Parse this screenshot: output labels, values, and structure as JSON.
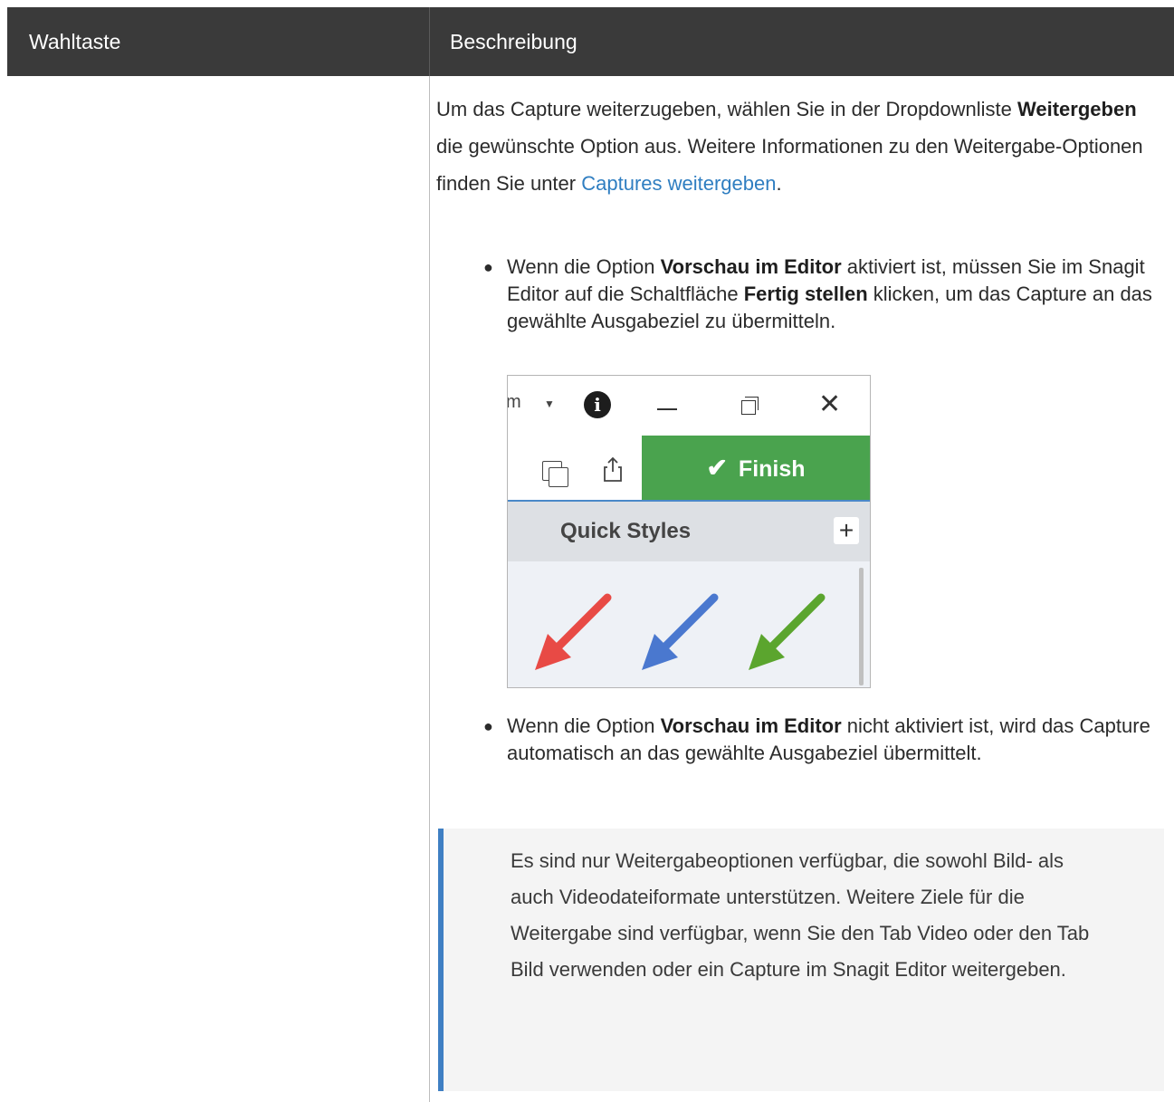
{
  "table": {
    "headers": [
      "Wahltaste",
      "Beschreibung"
    ]
  },
  "intro": {
    "t1": "Um das Capture weiterzugeben, wählen Sie in der Dropdownliste ",
    "b1": "Weitergeben",
    "t2": " die gewünschte Option aus. Weitere Informationen zu den Weitergabe-Optionen finden Sie unter ",
    "link": "Captures weitergeben",
    "t3": "."
  },
  "bullet1": {
    "t1": "Wenn die Option ",
    "b1": "Vorschau im Editor",
    "t2": " aktiviert ist, müssen Sie im Snagit Editor auf die Schaltfläche ",
    "b2": "Fertig stellen",
    "t3": " klicken, um das Capture an das gewählte Ausgabeziel zu übermitteln."
  },
  "bullet2": {
    "t1": "Wenn die Option ",
    "b1": "Vorschau im Editor",
    "t2": " nicht aktiviert ist, wird das Capture automatisch an das gewählte Ausgabeziel übermittelt."
  },
  "screenshot": {
    "truncated_label": "m",
    "finish_label": "Finish",
    "quick_styles_label": "Quick Styles",
    "arrow_colors": [
      "#e84a45",
      "#4a78cf",
      "#5ba52e"
    ]
  },
  "note": {
    "text": "Es sind nur Weitergabeoptionen verfügbar, die sowohl Bild- als auch Videodateiformate unterstützen. Weitere Ziele für die Weitergabe sind verfügbar, wenn Sie den Tab Video oder den Tab Bild verwenden oder ein Capture im Snagit Editor weitergeben."
  }
}
